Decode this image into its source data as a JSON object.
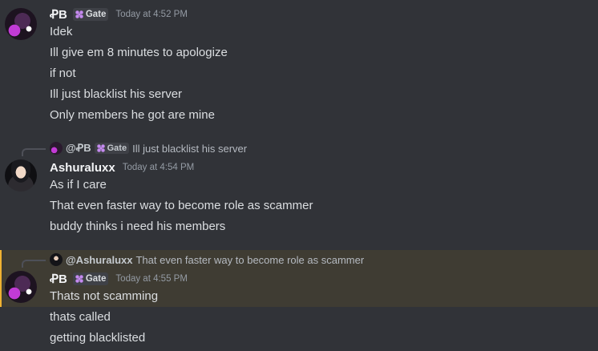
{
  "messages": [
    {
      "author": "PB",
      "author_display": "ꝒB",
      "tag": "Gate",
      "timestamp": "Today at 4:52 PM",
      "lines": [
        "Idek",
        "Ill give em 8 minutes to apologize",
        "if not",
        "Ill just blacklist his server",
        "Only members he got are mine"
      ]
    },
    {
      "reply": {
        "mention": "@ꝒB",
        "tag": "Gate",
        "text": "Ill just blacklist his server"
      },
      "author": "Ashuraluxx",
      "timestamp": "Today at 4:54 PM",
      "lines": [
        "As if I care",
        "That even faster way to become role as scammer",
        "buddy thinks i need his members"
      ]
    },
    {
      "reply": {
        "mention": "@Ashuraluxx",
        "text": "That even faster way to become role as scammer"
      },
      "author": "PB",
      "author_display": "ꝒB",
      "tag": "Gate",
      "timestamp": "Today at 4:55 PM",
      "lines": [
        "Thats not scamming",
        "thats called",
        "getting blacklisted"
      ]
    }
  ],
  "colors": {
    "background": "#313338",
    "highlight": "#3f3c33",
    "highlight_border": "#f0b232",
    "text": "#dbdee1",
    "muted": "#949ba4"
  }
}
